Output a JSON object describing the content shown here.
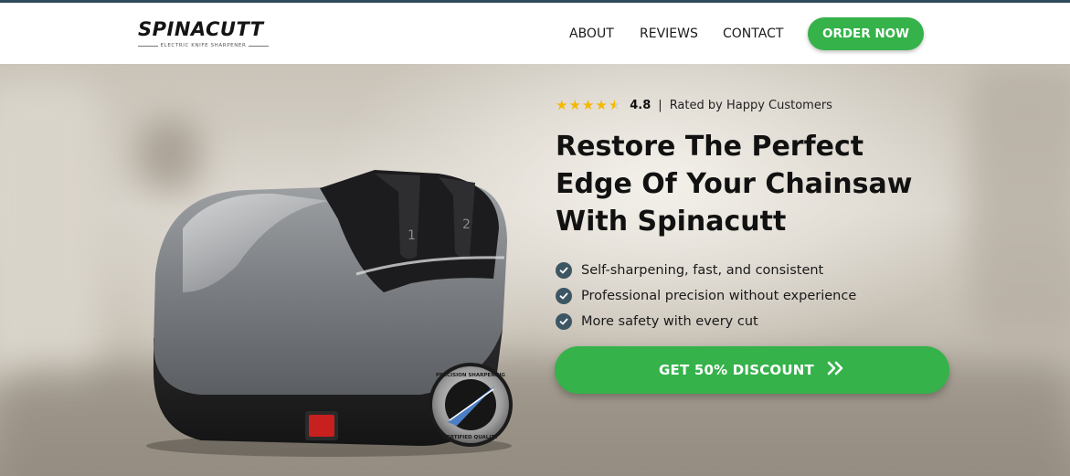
{
  "brand": {
    "name": "SPINACUTT",
    "tagline": "ELECTRIC KNIFE SHARPENER"
  },
  "nav": {
    "links": [
      {
        "label": "ABOUT"
      },
      {
        "label": "REVIEWS"
      },
      {
        "label": "CONTACT"
      }
    ],
    "order_label": "ORDER NOW"
  },
  "hero": {
    "rating": {
      "value": "4.8",
      "separator": "|",
      "text": "Rated by Happy Customers",
      "stars": 4.8
    },
    "headline": [
      "Restore The Perfect",
      "Edge Of Your Chainsaw",
      "With Spinacutt"
    ],
    "features": [
      "Self-sharpening, fast, and consistent",
      "Professional precision without experience",
      "More safety with every cut"
    ],
    "cta_label": "GET 50% DISCOUNT"
  },
  "product": {
    "slot_labels": [
      "1",
      "2"
    ],
    "seal_top": "PRECISION SHARPENING",
    "seal_bottom": "CERTIFIED QUALITY"
  },
  "colors": {
    "accent": "#35b24a",
    "check": "#3d5663",
    "star": "#f5b800",
    "header_border": "#2e4a5a"
  }
}
